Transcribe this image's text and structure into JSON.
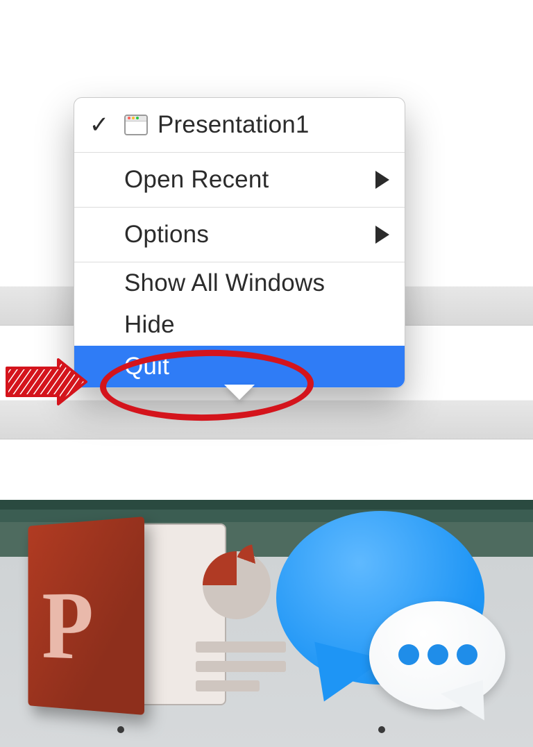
{
  "menu": {
    "window_item": {
      "label": "Presentation1",
      "checked": true
    },
    "open_recent": {
      "label": "Open Recent",
      "has_submenu": true
    },
    "options": {
      "label": "Options",
      "has_submenu": true
    },
    "show_all": {
      "label": "Show All Windows"
    },
    "hide": {
      "label": "Hide"
    },
    "quit": {
      "label": "Quit",
      "highlighted": true
    }
  },
  "dock": {
    "apps": [
      {
        "id": "powerpoint",
        "letter": "P",
        "running": true
      },
      {
        "id": "messages",
        "running": true
      }
    ]
  },
  "annotation": {
    "target": "quit",
    "style": "red-ellipse-with-arrow"
  },
  "colors": {
    "highlight": "#2f7cf6",
    "annotation": "#d4141c"
  }
}
